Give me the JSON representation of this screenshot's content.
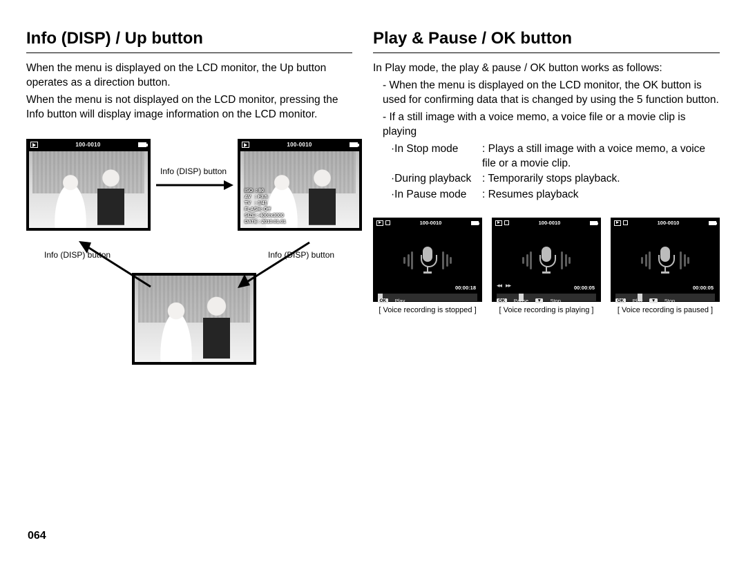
{
  "page_number": "064",
  "left": {
    "title": "Info (DISP) / Up button",
    "para1": "When the menu is displayed on the LCD monitor, the Up button operates as a direction button.",
    "para2": "When the menu is not displayed on the LCD monitor, pressing the Info button will display image information on the LCD monitor.",
    "lcd_counter": "100-0010",
    "info_overlay": "ISO  : 80\nAV   : F3.5\nTV   : 1/41\nFLASH: Off\nSIZE : 4000x3000\nDATE : 2010.01.01",
    "arrow_label": "Info (DISP) button"
  },
  "right": {
    "title": "Play & Pause / OK button",
    "intro": "In Play mode, the play & pause / OK button works as follows:",
    "bullet1": "When the menu is displayed on the LCD monitor, the OK button is used for confirming data that is changed by using the 5 function button.",
    "bullet2": "If a still image with a voice memo, a voice file or a movie clip is playing",
    "modes": [
      {
        "label": "·In Stop mode",
        "desc": ": Plays a still image with a voice memo, a voice file or a movie clip."
      },
      {
        "label": "·During playback",
        "desc": ": Temporarily stops playback."
      },
      {
        "label": "·In Pause mode",
        "desc": ": Resumes playback"
      }
    ],
    "screens": [
      {
        "counter": "100-0010",
        "time": "00:00:18",
        "cursor_pct": 0,
        "controls": [
          {
            "key": "OK",
            "label": "Play"
          }
        ],
        "show_rewff": false,
        "caption": "[ Voice recording is stopped ]"
      },
      {
        "counter": "100-0010",
        "time": "00:00:05",
        "cursor_pct": 22,
        "controls": [
          {
            "key": "OK",
            "label": "Pause"
          },
          {
            "key": "▼",
            "label": "Stop"
          }
        ],
        "show_rewff": true,
        "caption": "[ Voice recording is playing ]"
      },
      {
        "counter": "100-0010",
        "time": "00:00:05",
        "cursor_pct": 22,
        "controls": [
          {
            "key": "OK",
            "label": "Play"
          },
          {
            "key": "▼",
            "label": "Stop"
          }
        ],
        "show_rewff": false,
        "caption": "[ Voice recording is paused ]"
      }
    ]
  }
}
